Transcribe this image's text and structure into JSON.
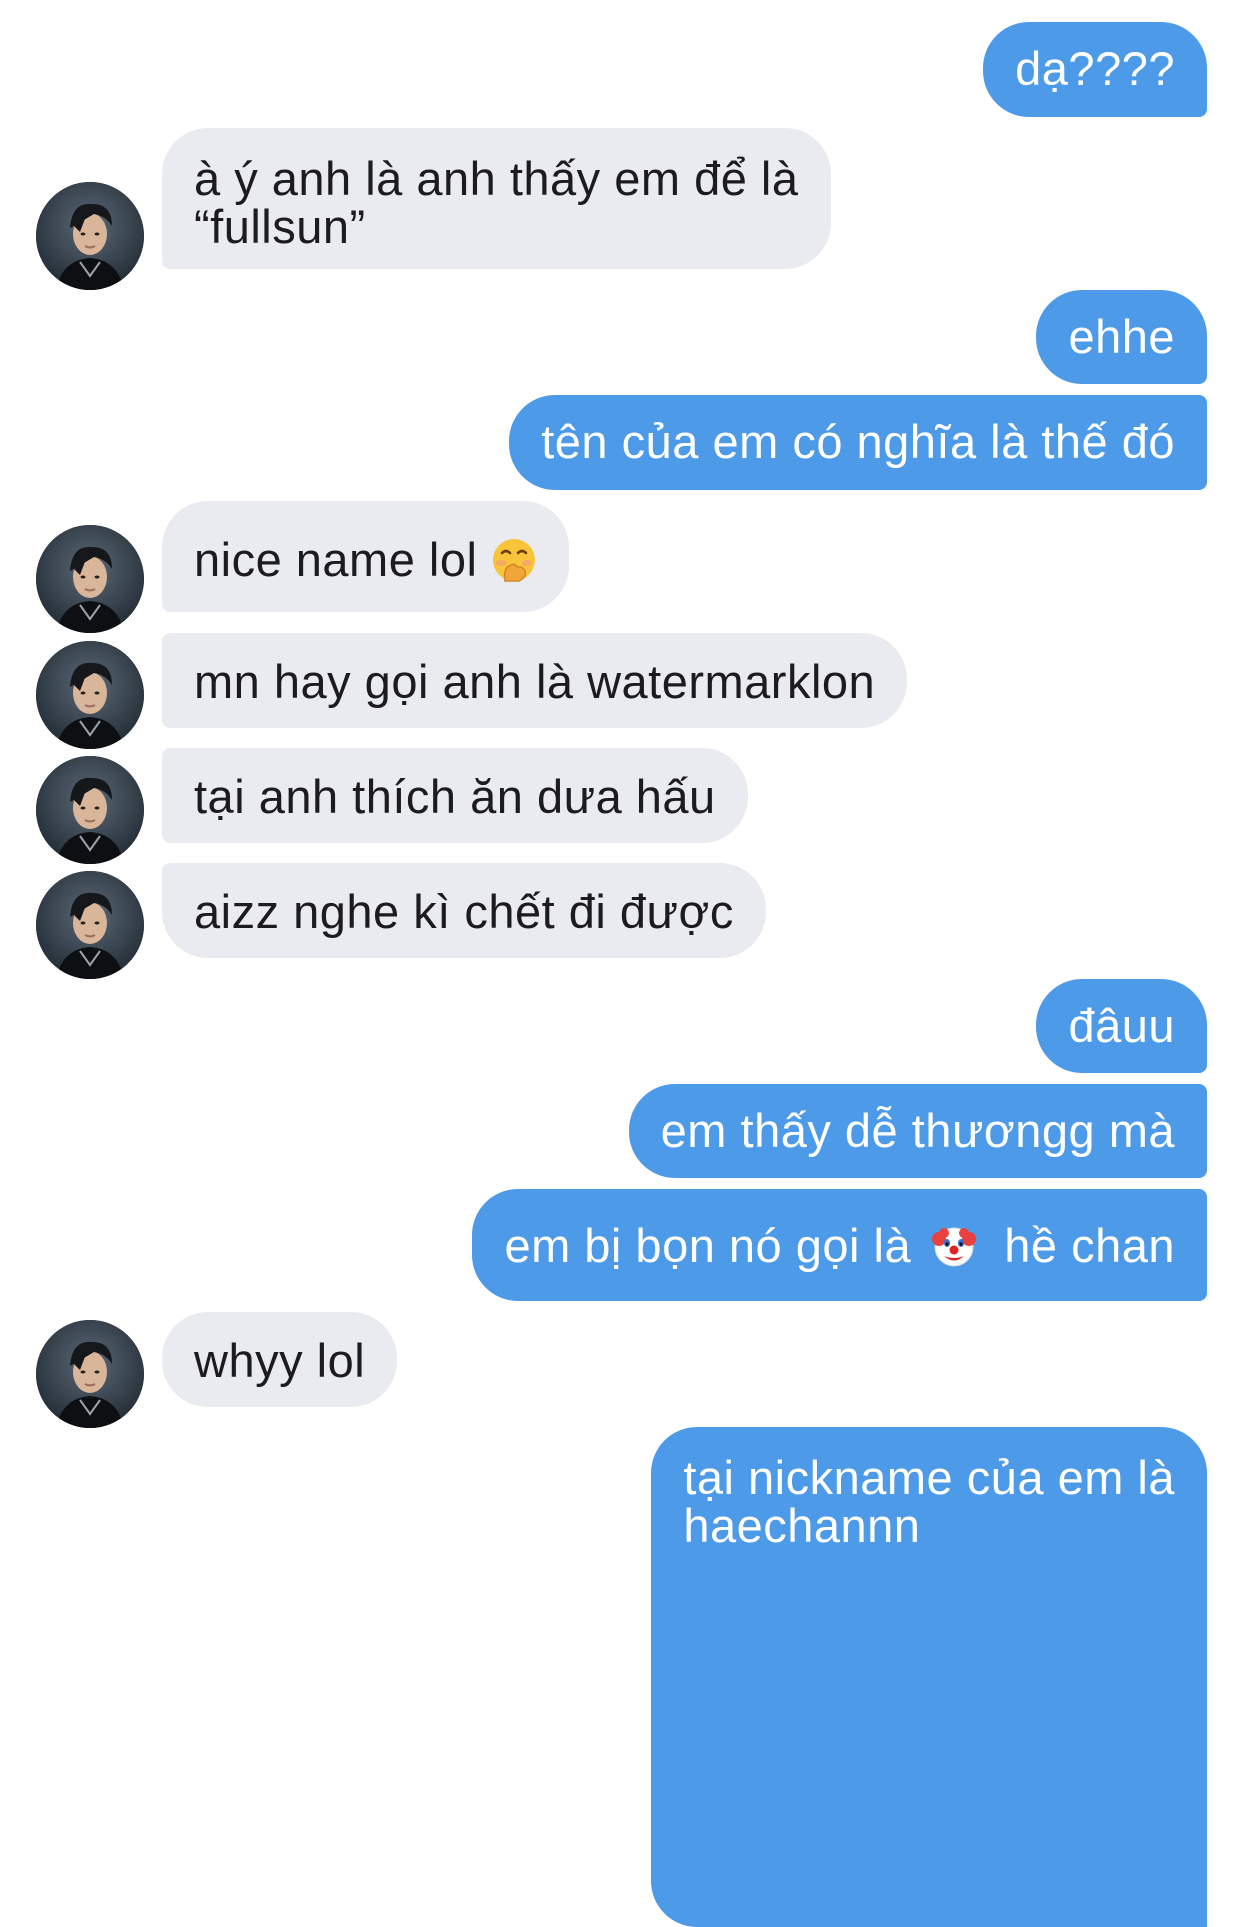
{
  "messages": [
    {
      "side": "out",
      "text": "dạ????"
    },
    {
      "side": "in",
      "text": "à ý anh là anh thấy em để là",
      "text2": "“fullsun”"
    },
    {
      "side": "out",
      "text": "ehhe"
    },
    {
      "side": "out",
      "text": "tên của em có nghĩa là thế đó"
    },
    {
      "side": "in",
      "text": "nice name lol",
      "emoji": "hand-over-mouth-emoji"
    },
    {
      "side": "in",
      "text": "mn hay gọi anh là watermarklon"
    },
    {
      "side": "in",
      "text": "tại anh thích ăn dưa hấu"
    },
    {
      "side": "in",
      "text": "aizz nghe kì chết đi được"
    },
    {
      "side": "out",
      "text": "đâuu"
    },
    {
      "side": "out",
      "text": "em thấy dễ thươngg mà"
    },
    {
      "side": "out",
      "text": "em bị bọn nó gọi là",
      "emoji": "clown-face-emoji",
      "text_after": "hề chan"
    },
    {
      "side": "in",
      "text": "whyy lol"
    },
    {
      "side": "out",
      "text": "tại nickname của em là",
      "text2": "haechannn"
    }
  ],
  "colors": {
    "outgoing_bubble": "#4d9ae8",
    "incoming_bubble": "#e9ebf0",
    "outgoing_text": "#ffffff",
    "incoming_text": "#1c1c1e"
  },
  "icons": {
    "avatar": "contact-avatar-photo"
  }
}
